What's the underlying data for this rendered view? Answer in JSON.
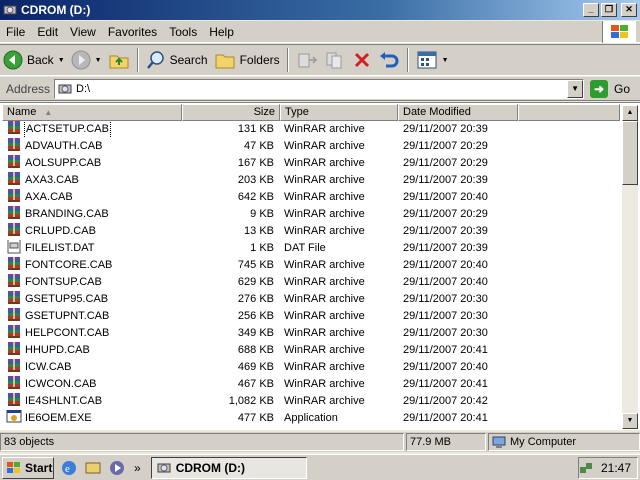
{
  "window": {
    "title": "CDROM (D:)"
  },
  "menu": [
    "File",
    "Edit",
    "View",
    "Favorites",
    "Tools",
    "Help"
  ],
  "toolbar": {
    "back": "Back",
    "search": "Search",
    "folders": "Folders"
  },
  "address": {
    "label": "Address",
    "value": "D:\\",
    "go": "Go"
  },
  "columns": {
    "name": "Name",
    "size": "Size",
    "type": "Type",
    "date": "Date Modified"
  },
  "files": [
    {
      "name": "ACTSETUP.CAB",
      "size": "131 KB",
      "type": "WinRAR archive",
      "date": "29/11/2007 20:39",
      "icon": "archive"
    },
    {
      "name": "ADVAUTH.CAB",
      "size": "47 KB",
      "type": "WinRAR archive",
      "date": "29/11/2007 20:29",
      "icon": "archive"
    },
    {
      "name": "AOLSUPP.CAB",
      "size": "167 KB",
      "type": "WinRAR archive",
      "date": "29/11/2007 20:29",
      "icon": "archive"
    },
    {
      "name": "AXA3.CAB",
      "size": "203 KB",
      "type": "WinRAR archive",
      "date": "29/11/2007 20:39",
      "icon": "archive"
    },
    {
      "name": "AXA.CAB",
      "size": "642 KB",
      "type": "WinRAR archive",
      "date": "29/11/2007 20:40",
      "icon": "archive"
    },
    {
      "name": "BRANDING.CAB",
      "size": "9 KB",
      "type": "WinRAR archive",
      "date": "29/11/2007 20:29",
      "icon": "archive"
    },
    {
      "name": "CRLUPD.CAB",
      "size": "13 KB",
      "type": "WinRAR archive",
      "date": "29/11/2007 20:39",
      "icon": "archive"
    },
    {
      "name": "FILELIST.DAT",
      "size": "1 KB",
      "type": "DAT File",
      "date": "29/11/2007 20:39",
      "icon": "dat"
    },
    {
      "name": "FONTCORE.CAB",
      "size": "745 KB",
      "type": "WinRAR archive",
      "date": "29/11/2007 20:40",
      "icon": "archive"
    },
    {
      "name": "FONTSUP.CAB",
      "size": "629 KB",
      "type": "WinRAR archive",
      "date": "29/11/2007 20:40",
      "icon": "archive"
    },
    {
      "name": "GSETUP95.CAB",
      "size": "276 KB",
      "type": "WinRAR archive",
      "date": "29/11/2007 20:30",
      "icon": "archive"
    },
    {
      "name": "GSETUPNT.CAB",
      "size": "256 KB",
      "type": "WinRAR archive",
      "date": "29/11/2007 20:30",
      "icon": "archive"
    },
    {
      "name": "HELPCONT.CAB",
      "size": "349 KB",
      "type": "WinRAR archive",
      "date": "29/11/2007 20:30",
      "icon": "archive"
    },
    {
      "name": "HHUPD.CAB",
      "size": "688 KB",
      "type": "WinRAR archive",
      "date": "29/11/2007 20:41",
      "icon": "archive"
    },
    {
      "name": "ICW.CAB",
      "size": "469 KB",
      "type": "WinRAR archive",
      "date": "29/11/2007 20:40",
      "icon": "archive"
    },
    {
      "name": "ICWCON.CAB",
      "size": "467 KB",
      "type": "WinRAR archive",
      "date": "29/11/2007 20:41",
      "icon": "archive"
    },
    {
      "name": "IE4SHLNT.CAB",
      "size": "1,082 KB",
      "type": "WinRAR archive",
      "date": "29/11/2007 20:42",
      "icon": "archive"
    },
    {
      "name": "IE6OEM.EXE",
      "size": "477 KB",
      "type": "Application",
      "date": "29/11/2007 20:41",
      "icon": "exe"
    }
  ],
  "status": {
    "objects": "83 objects",
    "size": "77.9 MB",
    "location": "My Computer"
  },
  "taskbar": {
    "start": "Start",
    "task": "CDROM (D:)",
    "clock": "21:47"
  },
  "colors": {
    "titlebar": "#0a246a",
    "chrome": "#d4d0c8",
    "selection_outline": "#000000"
  }
}
